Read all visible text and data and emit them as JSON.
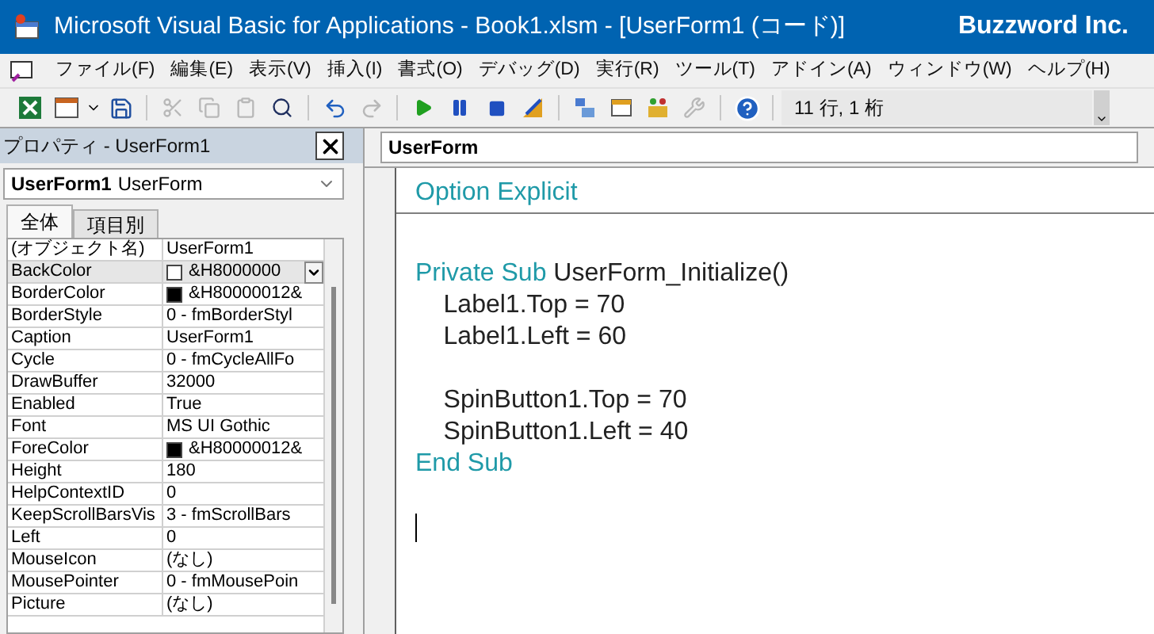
{
  "window": {
    "title": "Microsoft Visual Basic for Applications - Book1.xlsm - [UserForm1 (コード)]",
    "brand": "Buzzword Inc."
  },
  "menu": [
    "ファイル(F)",
    "編集(E)",
    "表示(V)",
    "挿入(I)",
    "書式(O)",
    "デバッグ(D)",
    "実行(R)",
    "ツール(T)",
    "アドイン(A)",
    "ウィンドウ(W)",
    "ヘルプ(H)"
  ],
  "toolbar": {
    "position": "11 行, 1 桁"
  },
  "properties": {
    "title": "プロパティ - UserForm1",
    "object_name": "UserForm1",
    "object_type": "UserForm",
    "tabs": [
      {
        "label": "全体",
        "selected": true
      },
      {
        "label": "項目別",
        "selected": false
      }
    ],
    "rows": [
      {
        "name": "(オブジェクト名)",
        "value": "UserForm1",
        "selected": false
      },
      {
        "name": "BackColor",
        "value": "&H8000000",
        "selected": true,
        "color": "#ffffff"
      },
      {
        "name": "BorderColor",
        "value": "&H80000012&",
        "selected": false,
        "color": "#000000"
      },
      {
        "name": "BorderStyle",
        "value": "0 - fmBorderStyl",
        "selected": false
      },
      {
        "name": "Caption",
        "value": "UserForm1",
        "selected": false
      },
      {
        "name": "Cycle",
        "value": "0 - fmCycleAllFo",
        "selected": false
      },
      {
        "name": "DrawBuffer",
        "value": "32000",
        "selected": false
      },
      {
        "name": "Enabled",
        "value": "True",
        "selected": false
      },
      {
        "name": "Font",
        "value": "MS UI Gothic",
        "selected": false
      },
      {
        "name": "ForeColor",
        "value": "&H80000012&",
        "selected": false,
        "color": "#000000"
      },
      {
        "name": "Height",
        "value": "180",
        "selected": false
      },
      {
        "name": "HelpContextID",
        "value": "0",
        "selected": false
      },
      {
        "name": "KeepScrollBarsVis",
        "value": "3 - fmScrollBars",
        "selected": false
      },
      {
        "name": "Left",
        "value": "0",
        "selected": false
      },
      {
        "name": "MouseIcon",
        "value": "(なし)",
        "selected": false
      },
      {
        "name": "MousePointer",
        "value": "0 - fmMousePoin",
        "selected": false
      },
      {
        "name": "Picture",
        "value": "(なし)",
        "selected": false
      }
    ]
  },
  "code": {
    "object": "UserForm",
    "lines": [
      {
        "kind": "declaration",
        "parts": [
          {
            "text": "Option Explicit",
            "kind": "keyword"
          }
        ]
      },
      {
        "kind": "blank"
      },
      {
        "kind": "code",
        "parts": [
          {
            "text": "Private Sub ",
            "kind": "keyword"
          },
          {
            "text": "UserForm_Initialize()",
            "kind": "plain"
          }
        ]
      },
      {
        "kind": "code",
        "parts": [
          {
            "text": "    Label1.Top = 70",
            "kind": "plain"
          }
        ]
      },
      {
        "kind": "code",
        "parts": [
          {
            "text": "    Label1.Left = 60",
            "kind": "plain"
          }
        ]
      },
      {
        "kind": "blank"
      },
      {
        "kind": "code",
        "parts": [
          {
            "text": "    SpinButton1.Top = 70",
            "kind": "plain"
          }
        ]
      },
      {
        "kind": "code",
        "parts": [
          {
            "text": "    SpinButton1.Left = 40",
            "kind": "plain"
          }
        ]
      },
      {
        "kind": "code",
        "parts": [
          {
            "text": "End Sub",
            "kind": "keyword"
          }
        ]
      },
      {
        "kind": "blank"
      },
      {
        "kind": "cursor"
      }
    ]
  }
}
